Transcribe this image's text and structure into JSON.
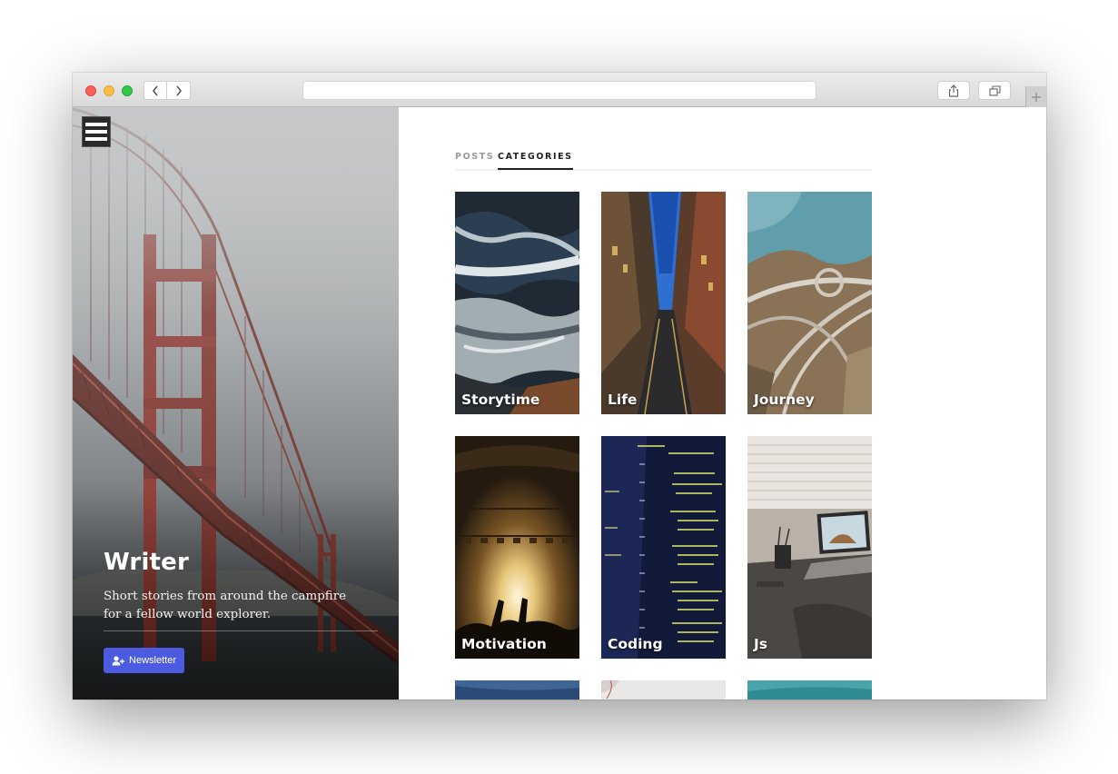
{
  "hero": {
    "title": "Writer",
    "tagline": "Short stories from around the campfire for a fellow world explorer.",
    "newsletter_label": "Newsletter"
  },
  "tabs": {
    "posts": "POSTS",
    "categories": "CATEGORIES",
    "active": "categories"
  },
  "categories": [
    {
      "label": "Storytime",
      "theme": "ocean-waves"
    },
    {
      "label": "Life",
      "theme": "narrow-street"
    },
    {
      "label": "Journey",
      "theme": "aerial-highway"
    },
    {
      "label": "Motivation",
      "theme": "concert-crowd"
    },
    {
      "label": "Coding",
      "theme": "code-screen"
    },
    {
      "label": "Js",
      "theme": "desk-laptop"
    }
  ],
  "colors": {
    "accent": "#4c5bdf",
    "tab_active": "#222222",
    "tab_inactive": "#9a9a9a"
  }
}
